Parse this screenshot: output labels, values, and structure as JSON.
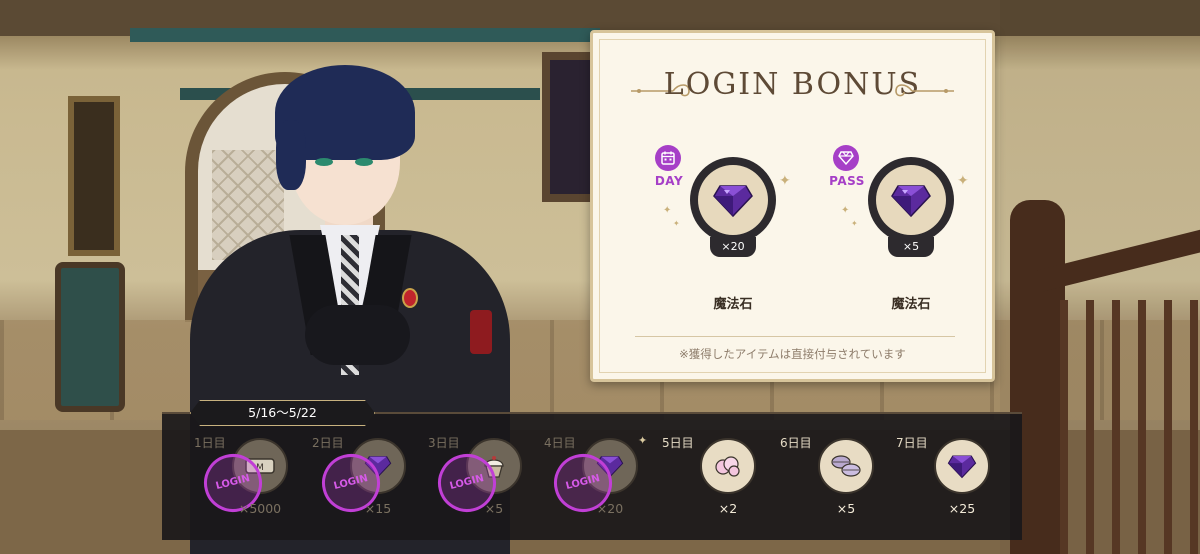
{
  "login_bonus": {
    "title": "LOGIN BONUS",
    "rewards": [
      {
        "tag": "DAY",
        "tag_icon": "calendar-icon",
        "item_icon": "magic-gem-icon",
        "quantity": "×20",
        "name": "魔法石"
      },
      {
        "tag": "PASS",
        "tag_icon": "diamond-icon",
        "item_icon": "magic-gem-icon",
        "quantity": "×5",
        "name": "魔法石"
      }
    ],
    "note": "※獲得したアイテムは直接付与されています"
  },
  "week": {
    "date_range": "5/16～5/22",
    "stamp_text": "LOGIN",
    "days": [
      {
        "label": "1日目",
        "quantity": "×5000",
        "item_icon": "madol-coin-icon",
        "claimed": true
      },
      {
        "label": "2日目",
        "quantity": "×15",
        "item_icon": "magic-gem-icon",
        "claimed": true
      },
      {
        "label": "3日目",
        "quantity": "×5",
        "item_icon": "cupcake-icon",
        "claimed": true
      },
      {
        "label": "4日目",
        "quantity": "×20",
        "item_icon": "magic-gem-icon",
        "claimed": true
      },
      {
        "label": "5日目",
        "quantity": "×2",
        "item_icon": "pink-cotton-icon",
        "claimed": false
      },
      {
        "label": "6日目",
        "quantity": "×5",
        "item_icon": "macaron-icon",
        "claimed": false
      },
      {
        "label": "7日目",
        "quantity": "×25",
        "item_icon": "magic-gem-icon",
        "claimed": false
      }
    ]
  },
  "colors": {
    "accent_purple": "#a63fc7",
    "stamp_magenta": "#c13fd6",
    "card_bg": "#fbf6ea",
    "panel_dark": "#1a181a",
    "gold_trim": "#c8b27f"
  }
}
